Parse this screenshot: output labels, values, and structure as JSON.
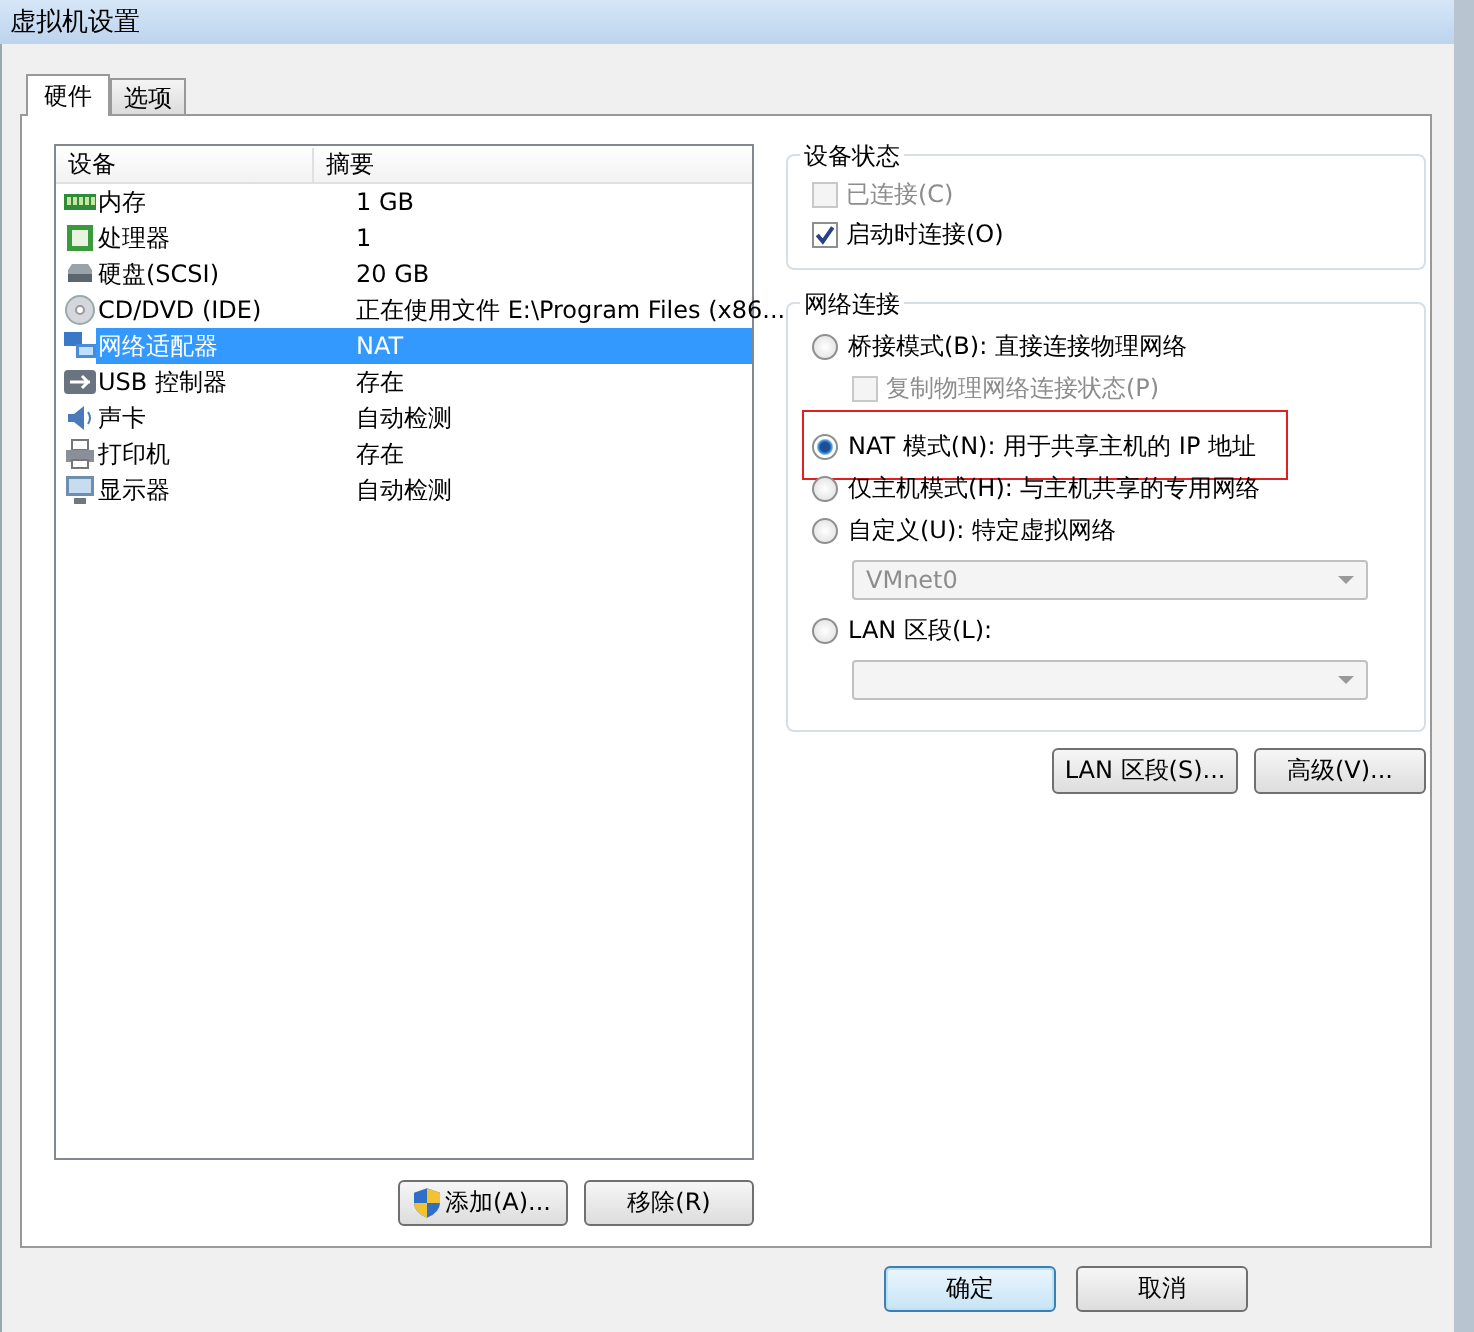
{
  "window": {
    "title": "虚拟机设置"
  },
  "tabs": [
    {
      "label": "硬件",
      "selected": true
    },
    {
      "label": "选项",
      "selected": false
    }
  ],
  "devices": {
    "columns": [
      "设备",
      "摘要"
    ],
    "rows": [
      {
        "kind": "memory",
        "name": "内存",
        "summary": "1 GB",
        "selected": false
      },
      {
        "kind": "cpu",
        "name": "处理器",
        "summary": "1",
        "selected": false
      },
      {
        "kind": "disk",
        "name": "硬盘(SCSI)",
        "summary": "20 GB",
        "selected": false
      },
      {
        "kind": "cdrom",
        "name": "CD/DVD (IDE)",
        "summary": "正在使用文件 E:\\Program Files (x86...",
        "selected": false
      },
      {
        "kind": "network",
        "name": "网络适配器",
        "summary": "NAT",
        "selected": true
      },
      {
        "kind": "usb",
        "name": "USB 控制器",
        "summary": "存在",
        "selected": false
      },
      {
        "kind": "sound",
        "name": "声卡",
        "summary": "自动检测",
        "selected": false
      },
      {
        "kind": "printer",
        "name": "打印机",
        "summary": "存在",
        "selected": false
      },
      {
        "kind": "display",
        "name": "显示器",
        "summary": "自动检测",
        "selected": false
      }
    ]
  },
  "list_buttons": [
    {
      "label": "添加(A)...",
      "shield": true
    },
    {
      "label": "移除(R)",
      "shield": false
    }
  ],
  "device_status": {
    "title": "设备状态",
    "items": [
      {
        "label": "已连接(C)",
        "checked": false,
        "disabled": true
      },
      {
        "label": "启动时连接(O)",
        "checked": true,
        "disabled": false
      }
    ]
  },
  "network_connection": {
    "title": "网络连接",
    "items": [
      {
        "kind": "radio",
        "label": "桥接模式(B): 直接连接物理网络",
        "selected": false,
        "disabled": false,
        "highlighted": false
      },
      {
        "kind": "checkbox",
        "label": "复制物理网络连接状态(P)",
        "checked": false,
        "disabled": true
      },
      {
        "kind": "radio",
        "label": "NAT 模式(N): 用于共享主机的 IP 地址",
        "selected": true,
        "disabled": false,
        "highlighted": true
      },
      {
        "kind": "radio",
        "label": "仅主机模式(H): 与主机共享的专用网络",
        "selected": false,
        "disabled": false,
        "highlighted": false
      },
      {
        "kind": "radio",
        "label": "自定义(U): 特定虚拟网络",
        "selected": false,
        "disabled": false,
        "highlighted": false
      },
      {
        "kind": "select",
        "value": "VMnet0",
        "disabled": true
      },
      {
        "kind": "radio",
        "label": "LAN 区段(L):",
        "selected": false,
        "disabled": false,
        "highlighted": false
      },
      {
        "kind": "select",
        "disabled": true
      }
    ]
  },
  "network_buttons": [
    "LAN 区段(S)...",
    "高级(V)..."
  ],
  "dialog_buttons": [
    {
      "label": "确定",
      "default": true
    },
    {
      "label": "取消",
      "default": false
    }
  ]
}
